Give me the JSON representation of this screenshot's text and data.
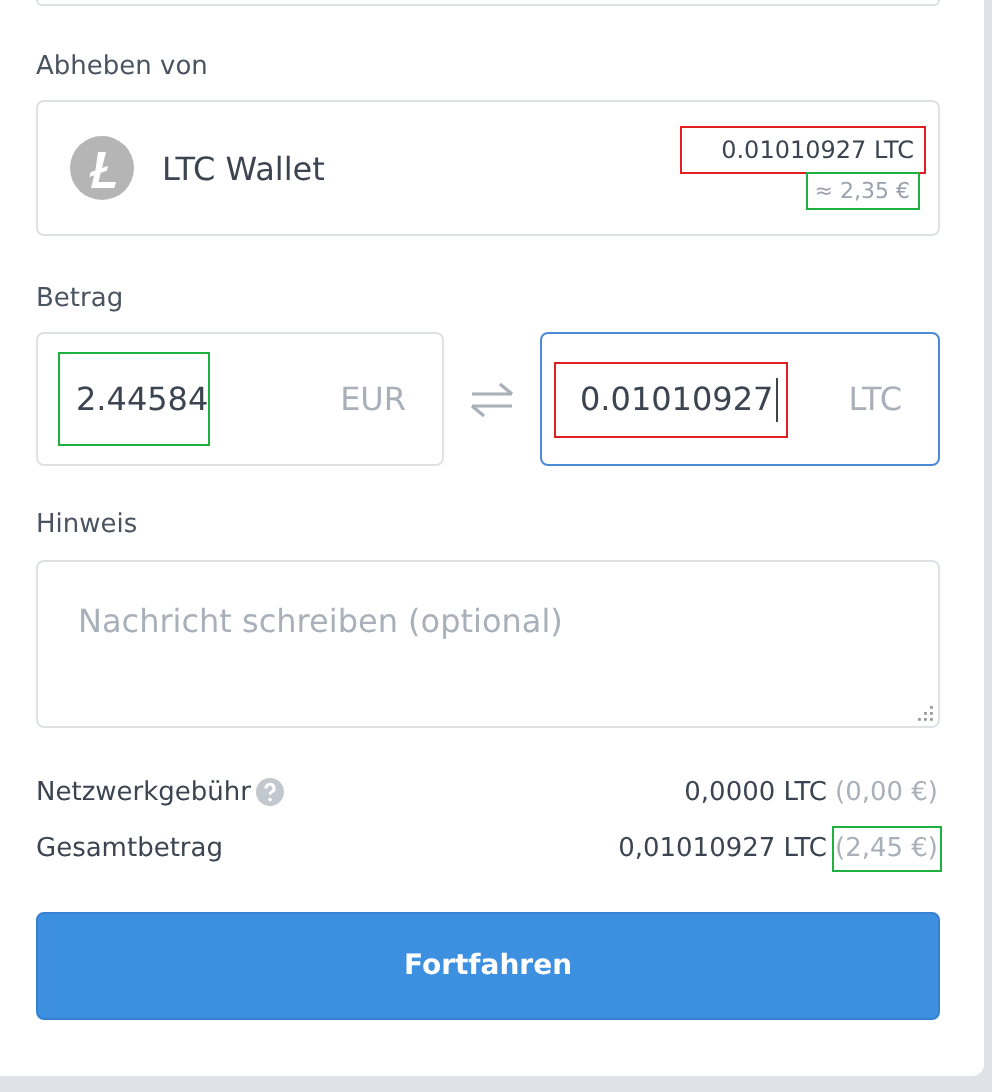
{
  "source": {
    "label": "Abheben von",
    "wallet_name": "LTC Wallet",
    "balance": {
      "text": "0.01010927 LTC",
      "color": "#e02020"
    },
    "fiat": {
      "text": "≈ 2,35 €",
      "color": "#20b040"
    }
  },
  "amount": {
    "label": "Betrag",
    "fields": [
      {
        "value": "2.44584",
        "currency": "EUR",
        "focused": false,
        "color": "#20b040"
      },
      {
        "value": "0.01010927",
        "currency": "LTC",
        "focused": true,
        "color": "#e02020"
      }
    ]
  },
  "note": {
    "label": "Hinweis",
    "placeholder": "Nachricht schreiben (optional)"
  },
  "summary": [
    {
      "label": "Netzwerkgebühr",
      "help": true,
      "crypto": "0,0000 LTC",
      "fiat": "(0,00 €)"
    },
    {
      "label": "Gesamtbetrag",
      "help": false,
      "crypto": "0,01010927 LTC",
      "fiat": "(2,45 €)",
      "color": "#20b040"
    }
  ],
  "button": "Fortfahren"
}
